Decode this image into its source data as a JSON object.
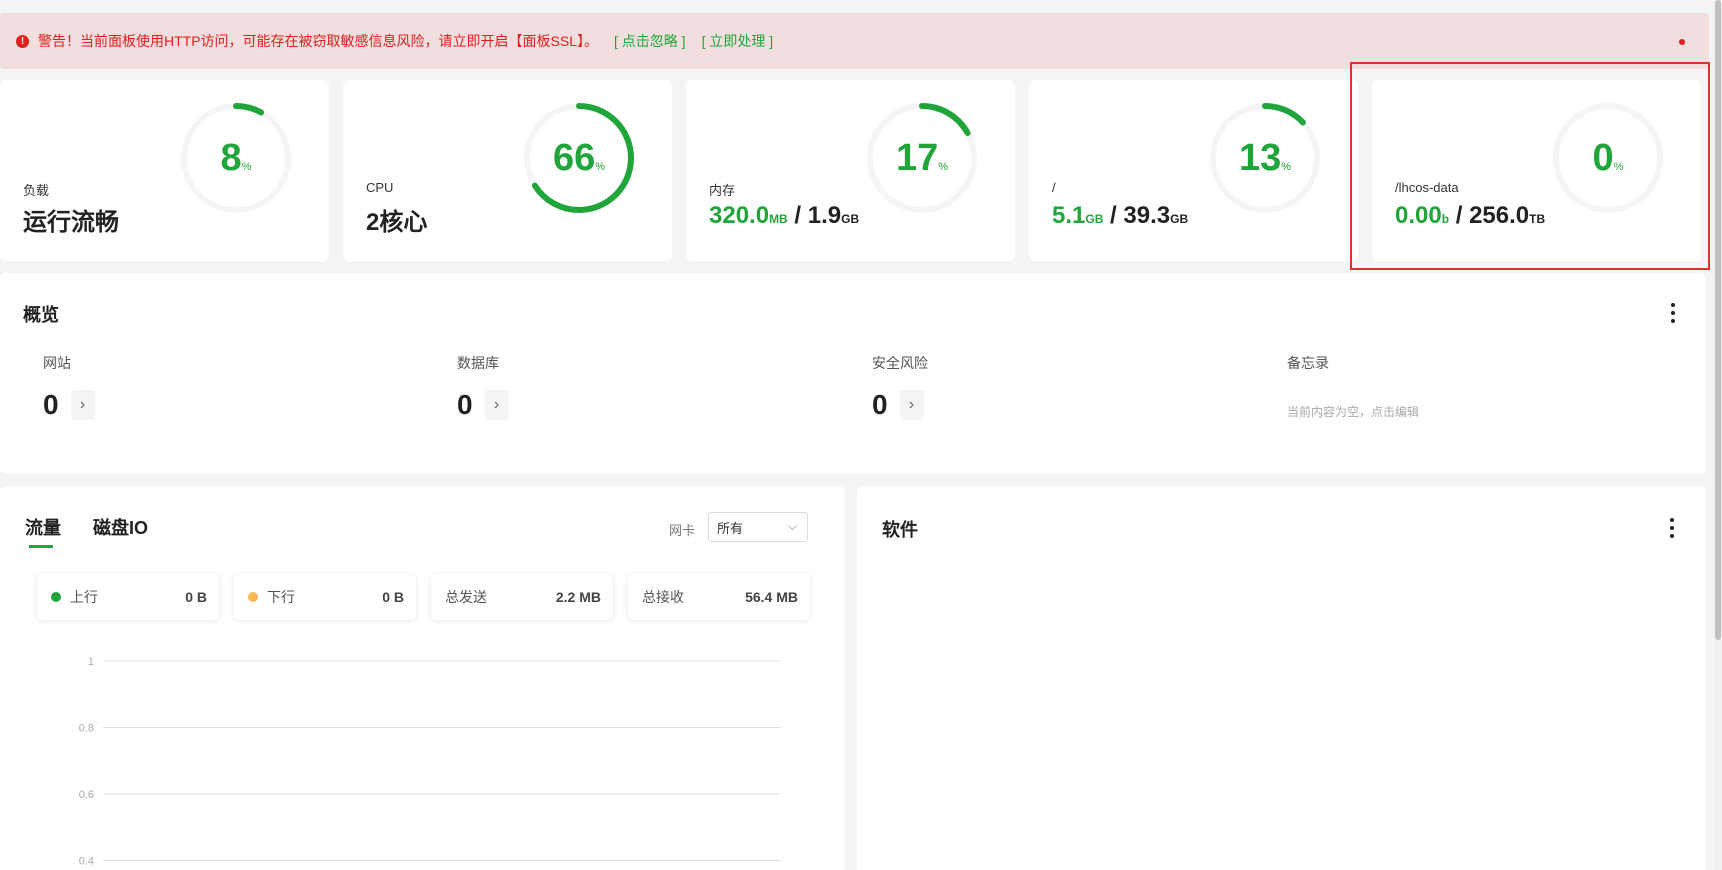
{
  "alert": {
    "icon": "warning-icon",
    "message": "警告！当前面板使用HTTP访问，可能存在被窃取敏感信息风险，请立即开启【面板SSL】。",
    "ignore_link": "[ 点击忽略 ]",
    "fix_link": "[ 立即处理 ]"
  },
  "status": {
    "load": {
      "label": "负载",
      "value": "运行流畅",
      "percent": "8",
      "unit": "%",
      "fraction": 0.08
    },
    "cpu": {
      "label": "CPU",
      "value": "2核心",
      "percent": "66",
      "unit": "%",
      "fraction": 0.66
    },
    "memory": {
      "label": "内存",
      "used": "320.0",
      "used_unit": "MB",
      "sep": " / ",
      "total": "1.9",
      "total_unit": "GB",
      "percent": "17",
      "unit": "%",
      "fraction": 0.17
    },
    "disk_root": {
      "label": "/",
      "used": "5.1",
      "used_unit": "GB",
      "sep": " / ",
      "total": "39.3",
      "total_unit": "GB",
      "percent": "13",
      "unit": "%",
      "fraction": 0.13
    },
    "disk_data": {
      "label": "/lhcos-data",
      "used": "0.00",
      "used_unit": "b",
      "sep": " / ",
      "total": "256.0",
      "total_unit": "TB",
      "percent": "0",
      "unit": "%",
      "fraction": 0.0
    }
  },
  "overview": {
    "title": "概览",
    "items": [
      {
        "label": "网站",
        "value": "0"
      },
      {
        "label": "数据库",
        "value": "0"
      },
      {
        "label": "安全风险",
        "value": "0"
      }
    ],
    "memo": {
      "label": "备忘录",
      "placeholder": "当前内容为空，点击编辑"
    }
  },
  "traffic": {
    "tabs": [
      "流量",
      "磁盘IO"
    ],
    "nic_label": "网卡",
    "nic_value": "所有",
    "pills": [
      {
        "label": "上行",
        "value": "0 B",
        "color": "#20a53a"
      },
      {
        "label": "下行",
        "value": "0 B",
        "color": "#f7b851"
      },
      {
        "label": "总发送",
        "value": "2.2 MB"
      },
      {
        "label": "总接收",
        "value": "56.4 MB"
      }
    ]
  },
  "chart_data": {
    "type": "line",
    "y_ticks": [
      "1",
      "0.8",
      "0.6",
      "0.4"
    ],
    "ylim": [
      0,
      1
    ],
    "series": []
  },
  "software": {
    "title": "软件"
  },
  "colors": {
    "accent": "#20a53a",
    "danger": "#e02020",
    "alert_bg": "#f2dede"
  }
}
